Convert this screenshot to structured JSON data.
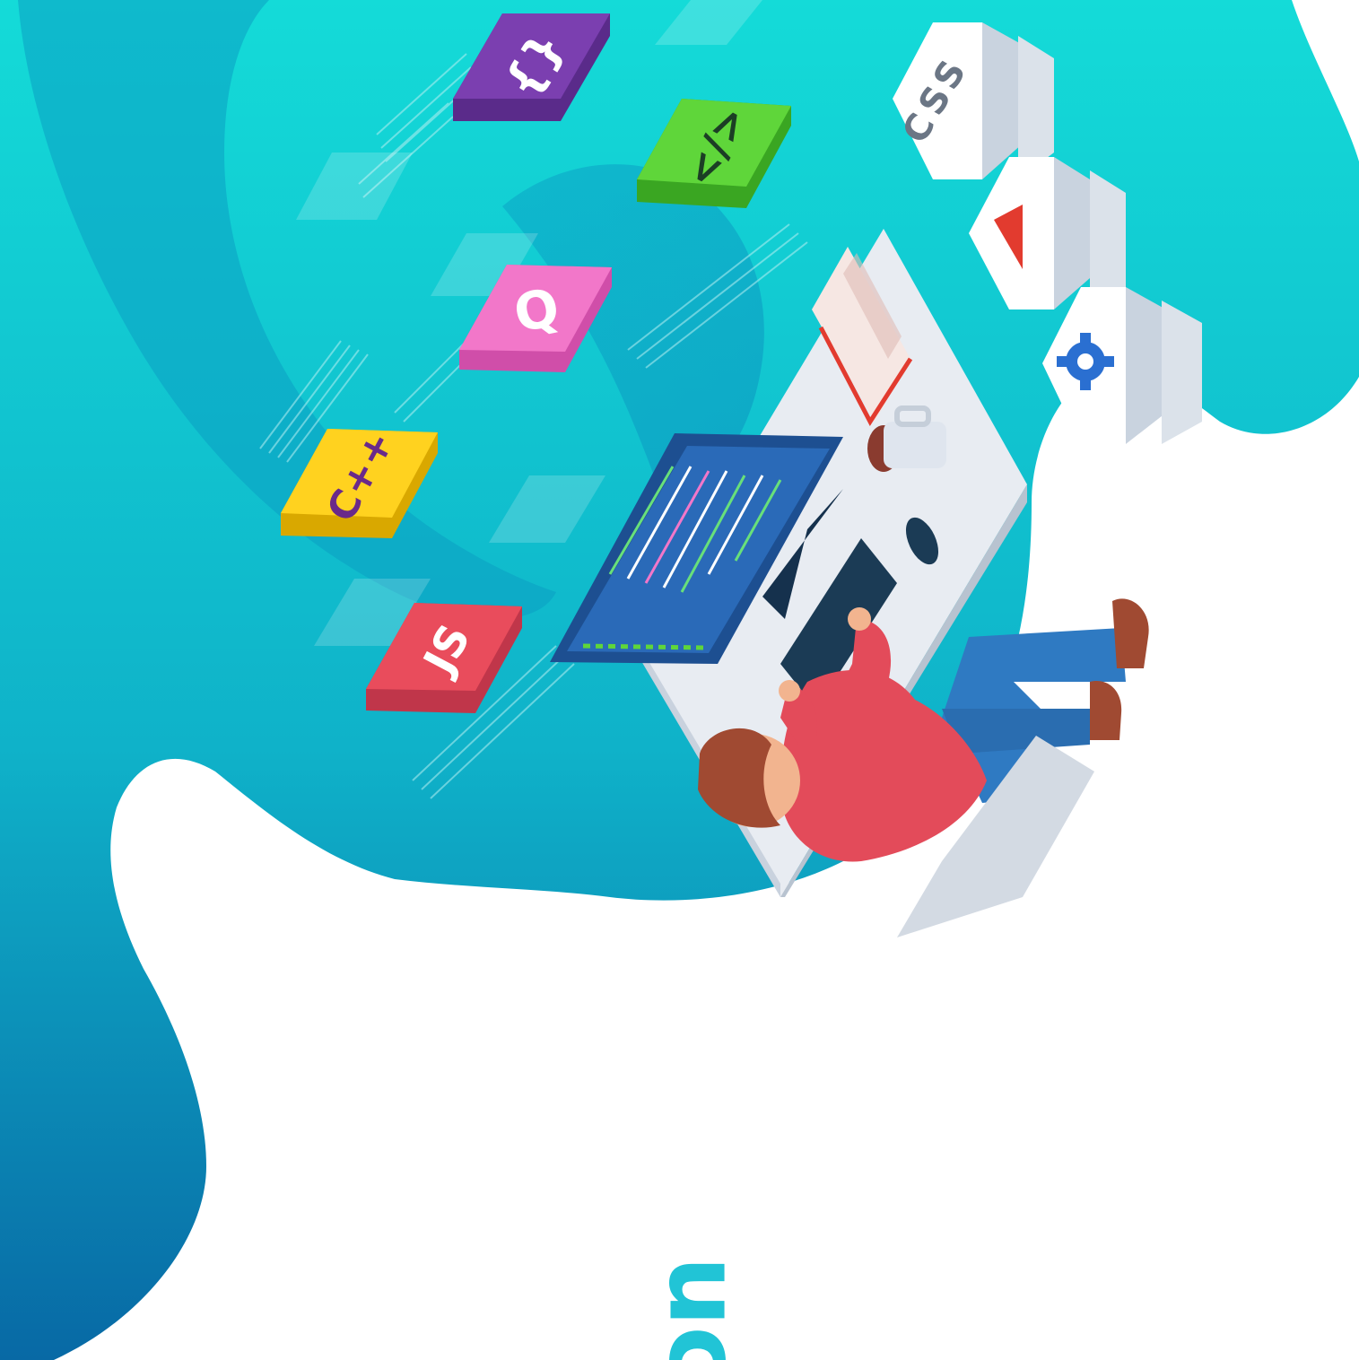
{
  "illustration": {
    "tiles": [
      {
        "label": "{}",
        "color": "#7b3fb0"
      },
      {
        "label": "</>",
        "color": "#5fd63a"
      },
      {
        "label": "Q",
        "color": "#f277c9"
      },
      {
        "label": "C++",
        "color": "#ffd21f"
      },
      {
        "label": "JS",
        "color": "#e94c5c"
      }
    ],
    "side_panels": [
      {
        "label": "CSS"
      },
      {
        "icon": "play-icon",
        "color": "#e23b2f"
      },
      {
        "icon": "gear-icon",
        "color": "#2a6fd1"
      }
    ],
    "bottom_text": "uc",
    "colors": {
      "blob_top": "#12d7d8",
      "blob_bottom": "#0a6fa8",
      "accent_text": "#21c4d6",
      "shirt": "#e34b5a",
      "pants": "#2f7ac2",
      "desk": "#e8ecf2",
      "monitor": "#1d4f91"
    }
  }
}
